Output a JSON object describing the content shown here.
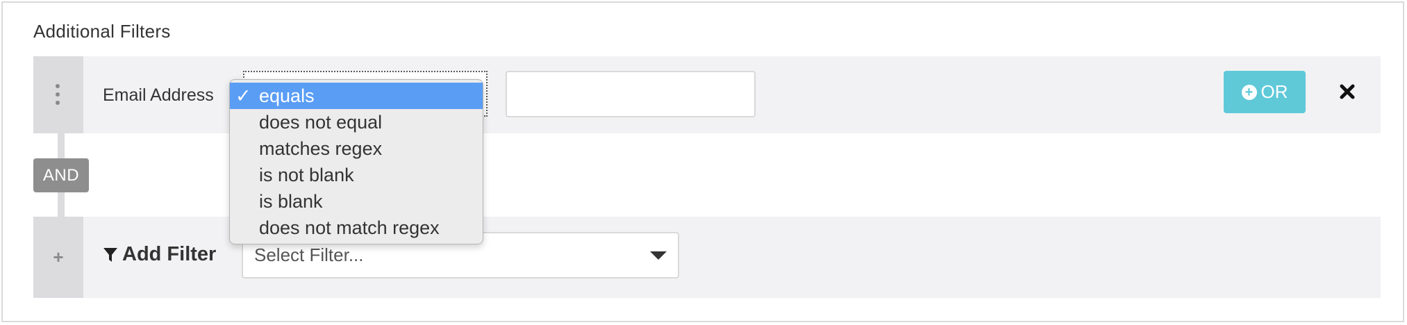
{
  "section": {
    "title": "Additional Filters"
  },
  "filter_row": {
    "field_label": "Email Address",
    "operator_options": [
      {
        "label": "equals",
        "selected": true
      },
      {
        "label": "does not equal",
        "selected": false
      },
      {
        "label": "matches regex",
        "selected": false
      },
      {
        "label": "is not blank",
        "selected": false
      },
      {
        "label": "is blank",
        "selected": false
      },
      {
        "label": "does not match regex",
        "selected": false
      }
    ],
    "check_mark": "✓",
    "value": "",
    "or_button_label": "OR",
    "remove_icon": "close-icon"
  },
  "and_badge": "AND",
  "add_filter": {
    "label": "Add Filter",
    "placeholder": "Select Filter..."
  },
  "colors": {
    "accent_or": "#5fc9d8",
    "selected_option": "#5a9df5",
    "row_bg": "#f2f2f4",
    "handle_bg": "#dcdcdf",
    "and_badge_bg": "#8e8e8e"
  }
}
